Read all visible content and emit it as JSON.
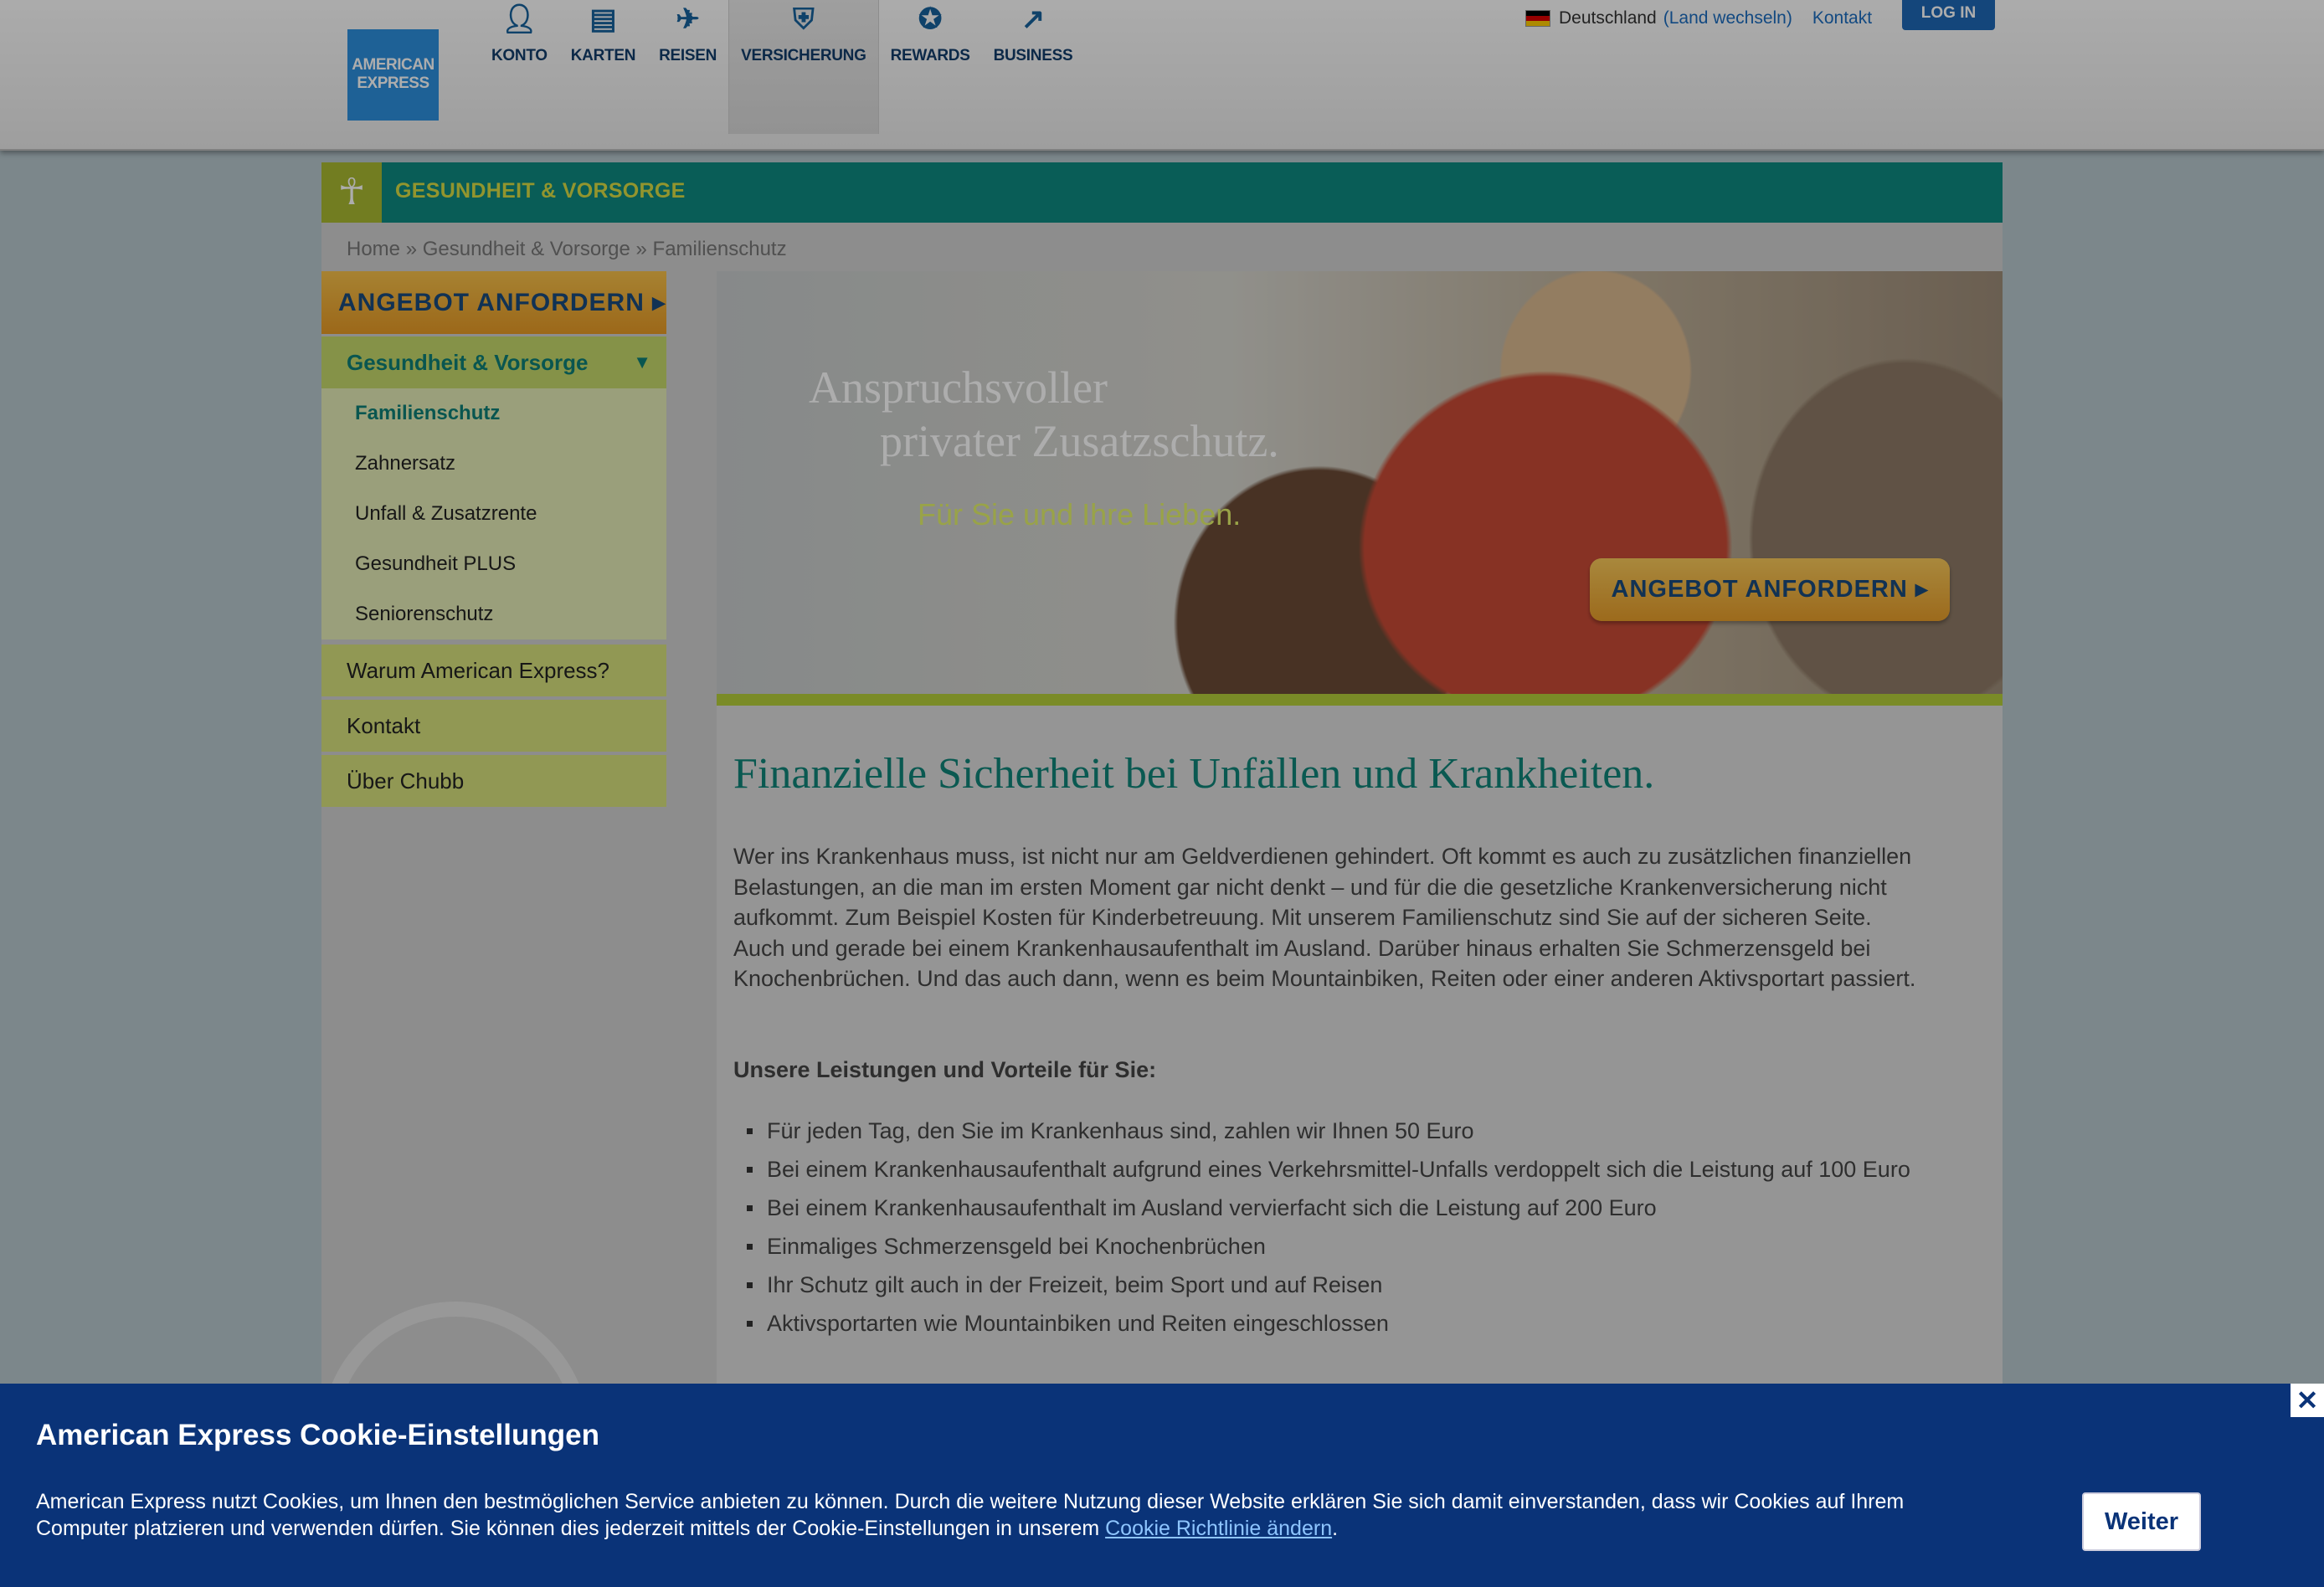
{
  "header": {
    "logo_line1": "AMERICAN",
    "logo_line2": "EXPRESS",
    "nav": [
      {
        "label": "KONTO",
        "icon": "person-icon"
      },
      {
        "label": "KARTEN",
        "icon": "cards-icon"
      },
      {
        "label": "REISEN",
        "icon": "airplane-icon"
      },
      {
        "label": "VERSICHERUNG",
        "icon": "shield-icon"
      },
      {
        "label": "REWARDS",
        "icon": "star-badge-icon"
      },
      {
        "label": "BUSINESS",
        "icon": "chart-icon"
      }
    ],
    "country": "Deutschland",
    "country_change": "(Land wechseln)",
    "contact": "Kontakt",
    "login": "LOG IN"
  },
  "section": {
    "title": "GESUNDHEIT & VORSORGE",
    "icon": "person-icon"
  },
  "breadcrumb": "Home » Gesundheit & Vorsorge » Familienschutz",
  "sidebar": {
    "cta": "ANGEBOT ANFORDERN",
    "category": "Gesundheit & Vorsorge",
    "sub_items": [
      "Familienschutz",
      "Zahnersatz",
      "Unfall & Zusatzrente",
      "Gesundheit PLUS",
      "Seniorenschutz"
    ],
    "main_items": [
      "Warum American Express?",
      "Kontakt",
      "Über Chubb"
    ]
  },
  "hero": {
    "line1": "Anspruchsvoller",
    "line2": "privater Zusatzschutz.",
    "subline": "Für Sie und Ihre Lieben.",
    "cta": "ANGEBOT ANFORDERN"
  },
  "content": {
    "heading": "Finanzielle Sicherheit bei Unfällen und Krankheiten.",
    "paragraph": "Wer ins Krankenhaus muss, ist nicht nur am Geldverdienen gehindert. Oft kommt es auch zu zusätzlichen finanziellen Belastungen, an die man im ersten Moment gar nicht denkt – und für die die gesetzliche Krankenversicherung nicht aufkommt. Zum Beispiel Kosten für Kinderbetreuung. Mit unserem Familienschutz sind Sie auf der sicheren Seite. Auch und gerade bei einem Krankenhausaufenthalt im Ausland. Darüber hinaus erhalten Sie Schmerzensgeld bei Knochenbrüchen. Und das auch dann, wenn es beim Mountainbiken, Reiten oder einer anderen Aktivsportart passiert.",
    "benefits_title": "Unsere Leistungen und Vorteile für Sie:",
    "benefits": [
      "Für jeden Tag, den Sie im Krankenhaus sind, zahlen wir Ihnen 50 Euro",
      "Bei einem Krankenhausaufenthalt aufgrund eines Verkehrsmittel-Unfalls verdoppelt sich die Leistung auf 100 Euro",
      "Bei einem Krankenhausaufenthalt im Ausland vervierfacht sich die Leistung auf 200 Euro",
      "Einmaliges Schmerzensgeld bei Knochenbrüchen",
      "Ihr Schutz gilt auch in der Freizeit, beim Sport und auf Reisen",
      "Aktivsportarten wie Mountainbiken und Reiten eingeschlossen"
    ]
  },
  "cookie": {
    "title": "American Express Cookie-Einstellungen",
    "text": "American Express nutzt Cookies, um Ihnen den bestmöglichen Service anbieten zu können. Durch die weitere Nutzung dieser Website erklären Sie sich damit einverstanden, dass wir Cookies auf Ihrem Computer platzieren und verwenden dürfen. Sie können dies jederzeit mittels der Cookie-Einstellungen in unserem ",
    "link": "Cookie Richtlinie ändern",
    "text_end": ".",
    "button": "Weiter",
    "close": "✕"
  },
  "colors": {
    "brand_blue": "#2d8fdd",
    "teal": "#0e8a80",
    "lime": "#b4cd3a",
    "cta_orange": "#e69a26",
    "cookie_bg": "#0a3378"
  }
}
